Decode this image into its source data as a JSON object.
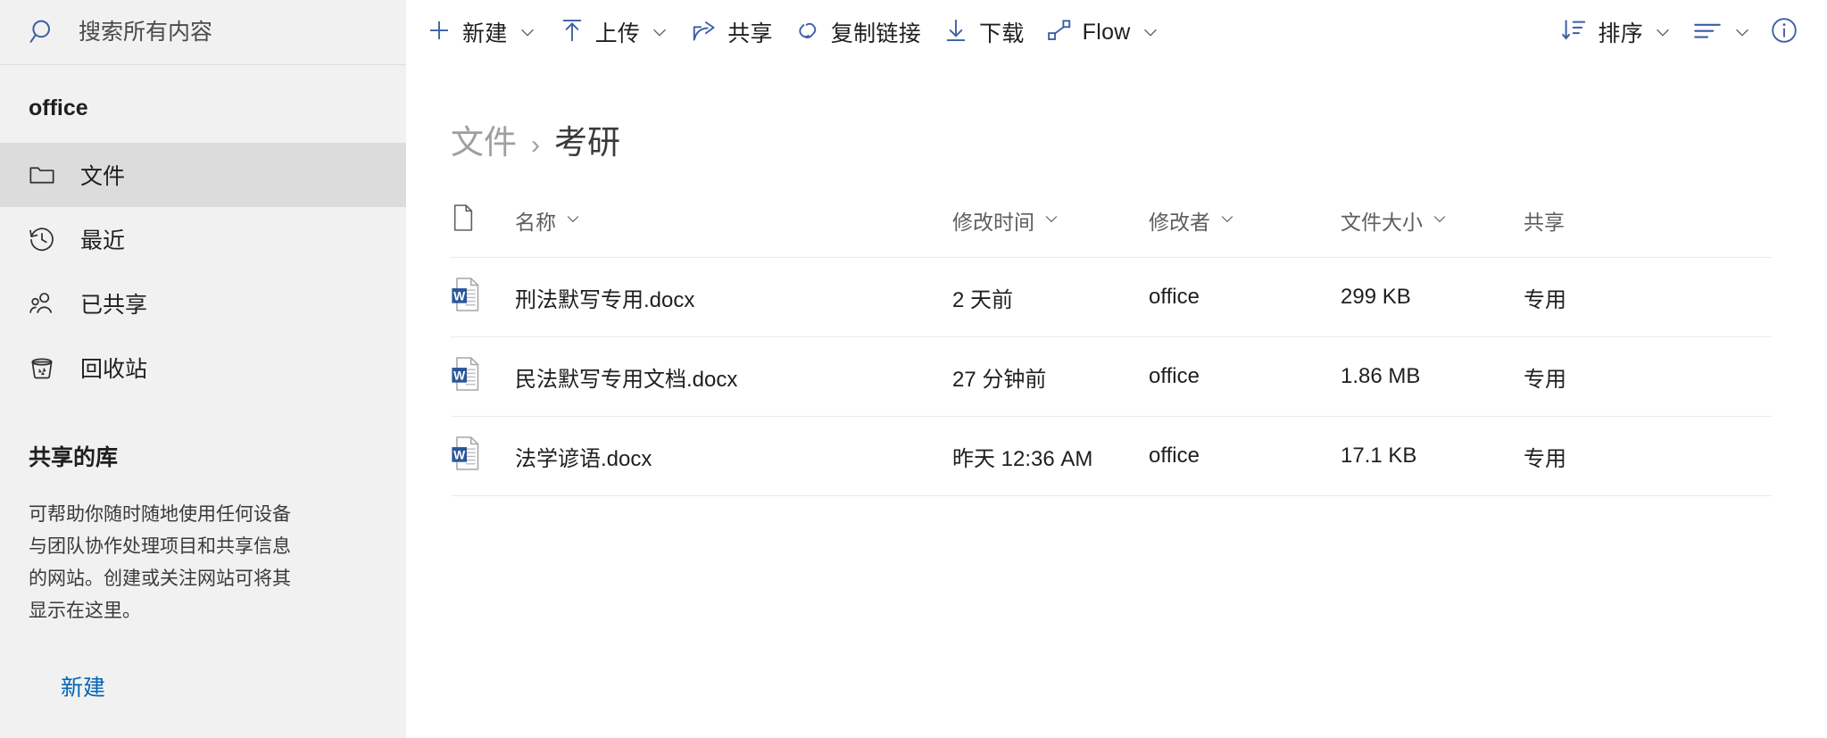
{
  "search": {
    "placeholder": "搜索所有内容",
    "value": "",
    "icon": "search-icon"
  },
  "command_bar": {
    "items": [
      {
        "id": "new",
        "label": "新建",
        "icon": "plus-icon",
        "has_chevron": true
      },
      {
        "id": "upload",
        "label": "上传",
        "icon": "upload-arrow-icon",
        "has_chevron": true
      },
      {
        "id": "share",
        "label": "共享",
        "icon": "share-icon",
        "has_chevron": false
      },
      {
        "id": "copylink",
        "label": "复制链接",
        "icon": "link-icon",
        "has_chevron": false
      },
      {
        "id": "download",
        "label": "下载",
        "icon": "download-icon",
        "has_chevron": false
      },
      {
        "id": "flow",
        "label": "Flow",
        "icon": "flow-icon",
        "has_chevron": true
      },
      {
        "id": "sort",
        "label": "排序",
        "icon": "sort-icon",
        "has_chevron": true
      },
      {
        "id": "view",
        "label": "",
        "icon": "view-list-icon",
        "has_chevron": true
      },
      {
        "id": "info",
        "label": "",
        "icon": "info-circle-icon",
        "has_chevron": false
      }
    ]
  },
  "sidebar": {
    "site_title": "office",
    "items": [
      {
        "label": "文件",
        "icon": "folder-icon",
        "selected": true
      },
      {
        "label": "最近",
        "icon": "clock-history-icon",
        "selected": false
      },
      {
        "label": "已共享",
        "icon": "people-icon",
        "selected": false
      },
      {
        "label": "回收站",
        "icon": "recycle-bin-icon",
        "selected": false
      }
    ],
    "shared_libraries": {
      "heading": "共享的库",
      "description": "可帮助你随时随地使用任何设备与团队协作处理项目和共享信息的网站。创建或关注网站可将其显示在这里。",
      "new_link": "新建"
    }
  },
  "breadcrumb": {
    "root": "文件",
    "separator": "›",
    "current": "考研"
  },
  "file_list": {
    "columns": [
      {
        "key": "icon",
        "label": "",
        "has_chevron": false,
        "icon": "document-icon"
      },
      {
        "key": "name",
        "label": "名称",
        "has_chevron": true
      },
      {
        "key": "modified",
        "label": "修改时间",
        "has_chevron": true
      },
      {
        "key": "by",
        "label": "修改者",
        "has_chevron": true
      },
      {
        "key": "size",
        "label": "文件大小",
        "has_chevron": true
      },
      {
        "key": "share",
        "label": "共享",
        "has_chevron": false
      }
    ],
    "rows": [
      {
        "icon": "word-file-icon",
        "name": "刑法默写专用.docx",
        "modified": "2 天前",
        "by": "office",
        "size": "299 KB",
        "share": "专用"
      },
      {
        "icon": "word-file-icon",
        "name": "民法默写专用文档.docx",
        "modified": "27 分钟前",
        "by": "office",
        "size": "1.86 MB",
        "share": "专用"
      },
      {
        "icon": "word-file-icon",
        "name": "法学谚语.docx",
        "modified": "昨天 12:36 AM",
        "by": "office",
        "size": "17.1 KB",
        "share": "专用"
      }
    ]
  },
  "colors": {
    "accent": "#0364b8",
    "sidebar_bg": "#f1f1f1",
    "selected_bg": "#dcdcdc",
    "word_blue": "#2b579a",
    "text": "#201f1e",
    "muted": "#605e5c"
  }
}
